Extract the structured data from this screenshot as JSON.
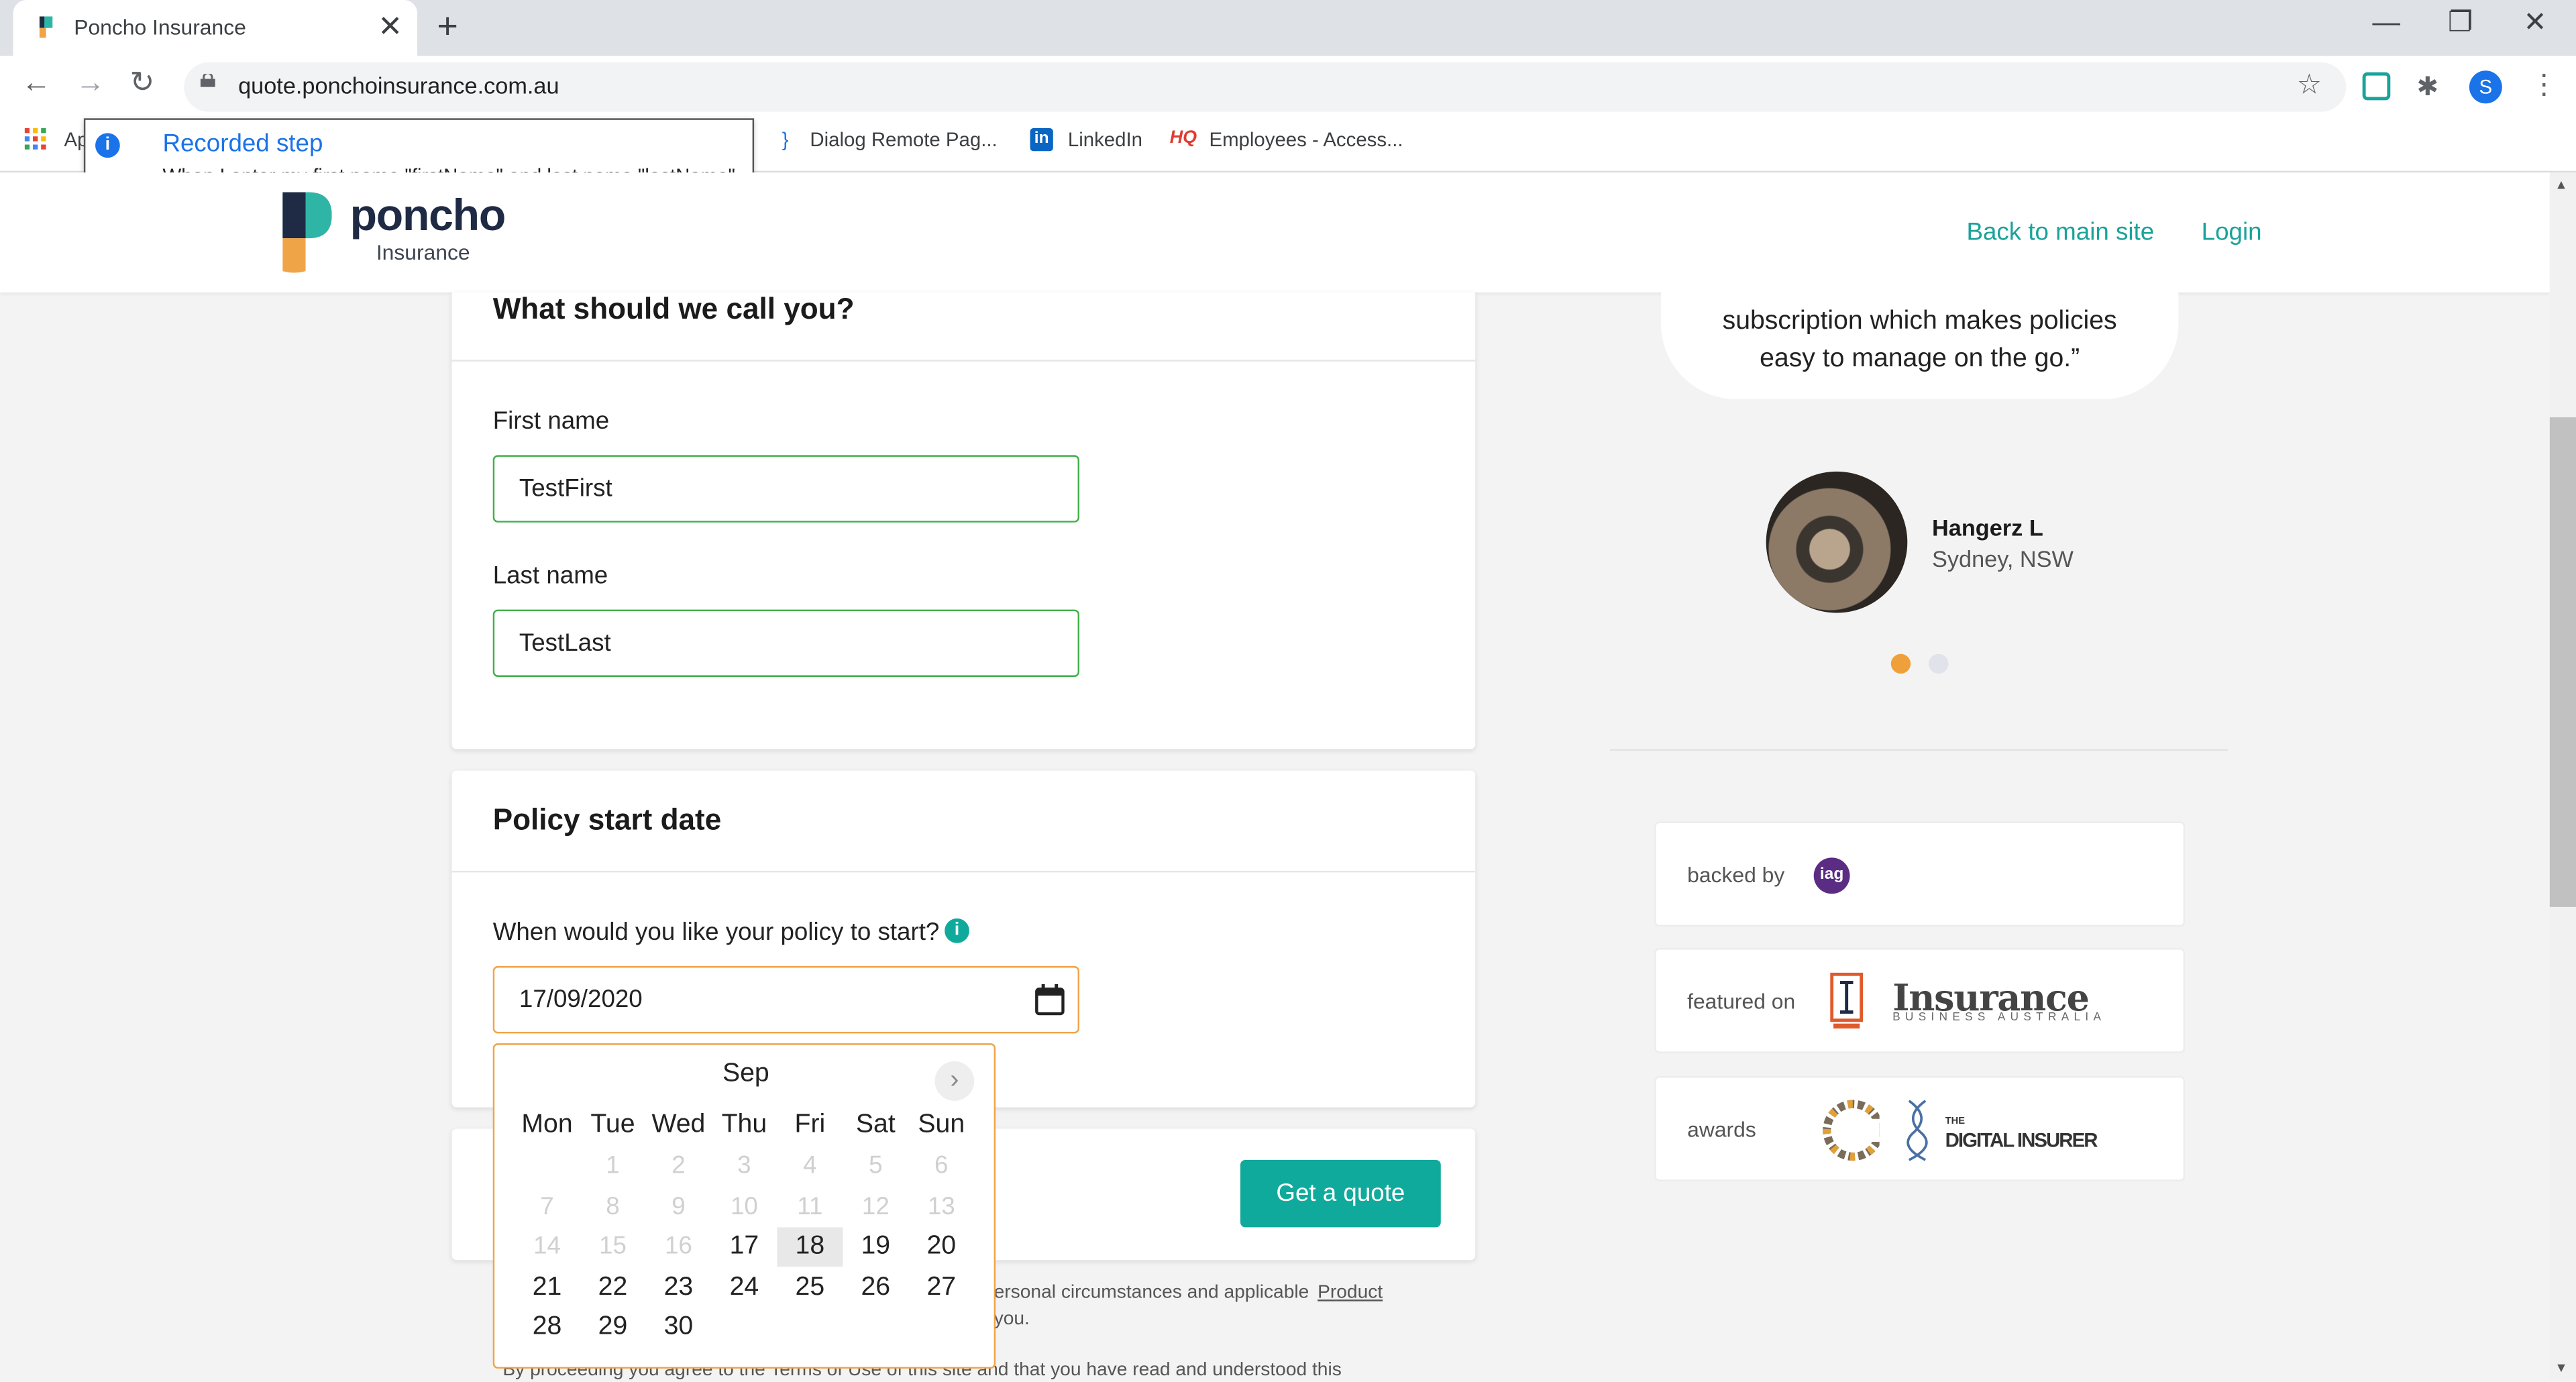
{
  "browser": {
    "tab_title": "Poncho Insurance",
    "url": "quote.ponchoinsurance.com.au",
    "profile_initial": "S",
    "bookmarks": [
      "Ap",
      "Dialog Remote Pag...",
      "LinkedIn",
      "Employees - Access..."
    ]
  },
  "recorder": {
    "title": "Recorded step",
    "description": "When I enter my first name \"firstName\" and last name \"lastName\""
  },
  "site": {
    "logo_word": "poncho",
    "logo_sub": "Insurance",
    "nav": {
      "back": "Back to main site",
      "login": "Login"
    }
  },
  "name_card": {
    "title": "What should we call you?",
    "first_label": "First name",
    "first_value": "TestFirst",
    "last_label": "Last name",
    "last_value": "TestLast"
  },
  "policy_card": {
    "title": "Policy start date",
    "question": "When would you like your policy to start?",
    "date_value": "17/09/2020"
  },
  "calendar": {
    "month": "Sep",
    "weekdays": [
      "Mon",
      "Tue",
      "Wed",
      "Thu",
      "Fri",
      "Sat",
      "Sun"
    ],
    "selected_day": "18"
  },
  "quote_button": "Get a quote",
  "legal": {
    "line1": "ersonal circumstances and applicable",
    "line1_link": "Product",
    "line2": "you.",
    "line3": "By proceeding you agree to the Terms of Use of this site and that you have read and understood this"
  },
  "testimonial": {
    "quote_line1": "subscription which makes policies",
    "quote_line2": "easy to manage on the go.”",
    "name": "Hangerz L",
    "location": "Sydney, NSW"
  },
  "trust": {
    "backed_by": "backed by",
    "backed_logo": "iag",
    "featured_on": "featured on",
    "featured_logo": "Insurance",
    "featured_logo_sub": "BUSINESS AUSTRALIA",
    "awards": "awards",
    "award_logo": "DIGITAL INSURER",
    "award_logo_pre": "THE"
  },
  "colors": {
    "accent": "#10aa9c",
    "highlight": "#f0a448",
    "valid": "#41b04a"
  }
}
